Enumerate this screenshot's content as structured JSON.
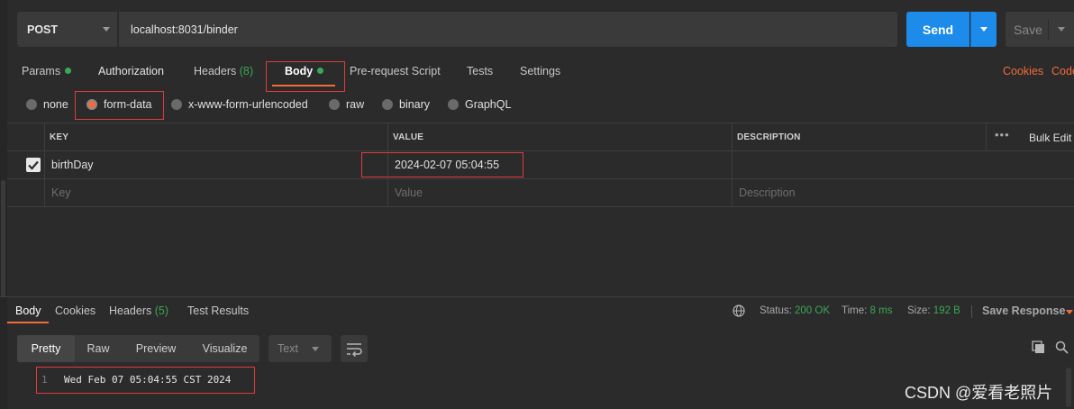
{
  "request": {
    "method": "POST",
    "url": "localhost:8031/binder",
    "send_label": "Send",
    "save_label": "Save"
  },
  "request_tabs": [
    {
      "label": "Params",
      "has_dot": true
    },
    {
      "label": "Authorization"
    },
    {
      "label": "Headers",
      "count": "(8)"
    },
    {
      "label": "Body",
      "has_dot": true,
      "active": true
    },
    {
      "label": "Pre-request Script"
    },
    {
      "label": "Tests"
    },
    {
      "label": "Settings"
    }
  ],
  "right_links": {
    "cookies": "Cookies",
    "code": "Code"
  },
  "body_types": [
    "none",
    "form-data",
    "x-www-form-urlencoded",
    "raw",
    "binary",
    "GraphQL"
  ],
  "selected_body_type": "form-data",
  "table": {
    "headers": {
      "key": "KEY",
      "value": "VALUE",
      "description": "DESCRIPTION"
    },
    "more_label": "•••",
    "bulk_edit": "Bulk Edit",
    "rows": [
      {
        "checked": true,
        "key": "birthDay",
        "value": "2024-02-07 05:04:55",
        "description": ""
      }
    ],
    "placeholders": {
      "key": "Key",
      "value": "Value",
      "description": "Description"
    }
  },
  "response": {
    "tabs": [
      {
        "label": "Body",
        "active": true
      },
      {
        "label": "Cookies"
      },
      {
        "label": "Headers",
        "count": "(5)"
      },
      {
        "label": "Test Results"
      }
    ],
    "status_label": "Status:",
    "status_value": "200 OK",
    "time_label": "Time:",
    "time_value": "8 ms",
    "size_label": "Size:",
    "size_value": "192 B",
    "save_response": "Save Response",
    "view_modes": [
      "Pretty",
      "Raw",
      "Preview",
      "Visualize"
    ],
    "active_view": "Pretty",
    "format": "Text",
    "lines": [
      {
        "num": "1",
        "text": "Wed Feb 07 05:04:55 CST 2024"
      }
    ]
  },
  "watermark": "CSDN @爱看老照片",
  "colors": {
    "accent": "#f26b3a",
    "primary": "#1c8bea",
    "success": "#3aa855",
    "highlight_box": "#e23b3b"
  }
}
